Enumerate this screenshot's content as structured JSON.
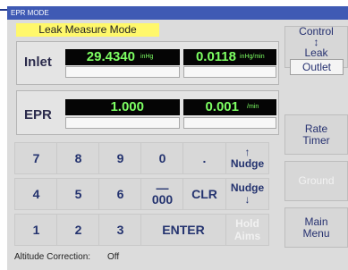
{
  "window": {
    "title": "EPR MODE"
  },
  "mode": {
    "label": "Leak Measure Mode"
  },
  "inlet": {
    "label": "Inlet",
    "pressure_value": "29.4340",
    "pressure_unit": "inHg",
    "rate_value": "0.0118",
    "rate_unit": "inHg/min"
  },
  "epr": {
    "label": "EPR",
    "ratio_value": "1.000",
    "rate_value": "0.001",
    "rate_unit": "/min"
  },
  "keypad": {
    "rows": [
      [
        "7",
        "8",
        "9",
        "0",
        "."
      ],
      [
        "4",
        "5",
        "6",
        "000",
        "CLR"
      ],
      [
        "1",
        "2",
        "3",
        "ENTER"
      ]
    ],
    "nudge_up": "Nudge",
    "nudge_down": "Nudge",
    "hold_aims": "Hold\nAims"
  },
  "side_buttons": {
    "control": "Control",
    "leak_measure": "Leak\nMeasure",
    "outlet": "Outlet",
    "rate_timer": "Rate\nTimer",
    "ground": "Ground",
    "main_menu": "Main\nMenu"
  },
  "footer": {
    "label": "Altitude Correction:",
    "value": "Off"
  },
  "colors": {
    "title_bar": "#3f5ab4",
    "mode_highlight": "#fff86b",
    "lcd_text": "#7dff63",
    "panel_bg": "#dcdcdc"
  }
}
